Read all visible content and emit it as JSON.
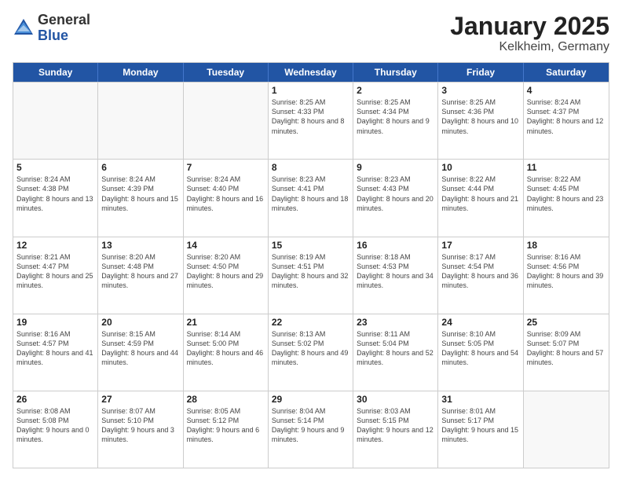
{
  "logo": {
    "general": "General",
    "blue": "Blue"
  },
  "title": "January 2025",
  "location": "Kelkheim, Germany",
  "header_days": [
    "Sunday",
    "Monday",
    "Tuesday",
    "Wednesday",
    "Thursday",
    "Friday",
    "Saturday"
  ],
  "weeks": [
    [
      {
        "day": "",
        "info": ""
      },
      {
        "day": "",
        "info": ""
      },
      {
        "day": "",
        "info": ""
      },
      {
        "day": "1",
        "info": "Sunrise: 8:25 AM\nSunset: 4:33 PM\nDaylight: 8 hours\nand 8 minutes."
      },
      {
        "day": "2",
        "info": "Sunrise: 8:25 AM\nSunset: 4:34 PM\nDaylight: 8 hours\nand 9 minutes."
      },
      {
        "day": "3",
        "info": "Sunrise: 8:25 AM\nSunset: 4:36 PM\nDaylight: 8 hours\nand 10 minutes."
      },
      {
        "day": "4",
        "info": "Sunrise: 8:24 AM\nSunset: 4:37 PM\nDaylight: 8 hours\nand 12 minutes."
      }
    ],
    [
      {
        "day": "5",
        "info": "Sunrise: 8:24 AM\nSunset: 4:38 PM\nDaylight: 8 hours\nand 13 minutes."
      },
      {
        "day": "6",
        "info": "Sunrise: 8:24 AM\nSunset: 4:39 PM\nDaylight: 8 hours\nand 15 minutes."
      },
      {
        "day": "7",
        "info": "Sunrise: 8:24 AM\nSunset: 4:40 PM\nDaylight: 8 hours\nand 16 minutes."
      },
      {
        "day": "8",
        "info": "Sunrise: 8:23 AM\nSunset: 4:41 PM\nDaylight: 8 hours\nand 18 minutes."
      },
      {
        "day": "9",
        "info": "Sunrise: 8:23 AM\nSunset: 4:43 PM\nDaylight: 8 hours\nand 20 minutes."
      },
      {
        "day": "10",
        "info": "Sunrise: 8:22 AM\nSunset: 4:44 PM\nDaylight: 8 hours\nand 21 minutes."
      },
      {
        "day": "11",
        "info": "Sunrise: 8:22 AM\nSunset: 4:45 PM\nDaylight: 8 hours\nand 23 minutes."
      }
    ],
    [
      {
        "day": "12",
        "info": "Sunrise: 8:21 AM\nSunset: 4:47 PM\nDaylight: 8 hours\nand 25 minutes."
      },
      {
        "day": "13",
        "info": "Sunrise: 8:20 AM\nSunset: 4:48 PM\nDaylight: 8 hours\nand 27 minutes."
      },
      {
        "day": "14",
        "info": "Sunrise: 8:20 AM\nSunset: 4:50 PM\nDaylight: 8 hours\nand 29 minutes."
      },
      {
        "day": "15",
        "info": "Sunrise: 8:19 AM\nSunset: 4:51 PM\nDaylight: 8 hours\nand 32 minutes."
      },
      {
        "day": "16",
        "info": "Sunrise: 8:18 AM\nSunset: 4:53 PM\nDaylight: 8 hours\nand 34 minutes."
      },
      {
        "day": "17",
        "info": "Sunrise: 8:17 AM\nSunset: 4:54 PM\nDaylight: 8 hours\nand 36 minutes."
      },
      {
        "day": "18",
        "info": "Sunrise: 8:16 AM\nSunset: 4:56 PM\nDaylight: 8 hours\nand 39 minutes."
      }
    ],
    [
      {
        "day": "19",
        "info": "Sunrise: 8:16 AM\nSunset: 4:57 PM\nDaylight: 8 hours\nand 41 minutes."
      },
      {
        "day": "20",
        "info": "Sunrise: 8:15 AM\nSunset: 4:59 PM\nDaylight: 8 hours\nand 44 minutes."
      },
      {
        "day": "21",
        "info": "Sunrise: 8:14 AM\nSunset: 5:00 PM\nDaylight: 8 hours\nand 46 minutes."
      },
      {
        "day": "22",
        "info": "Sunrise: 8:13 AM\nSunset: 5:02 PM\nDaylight: 8 hours\nand 49 minutes."
      },
      {
        "day": "23",
        "info": "Sunrise: 8:11 AM\nSunset: 5:04 PM\nDaylight: 8 hours\nand 52 minutes."
      },
      {
        "day": "24",
        "info": "Sunrise: 8:10 AM\nSunset: 5:05 PM\nDaylight: 8 hours\nand 54 minutes."
      },
      {
        "day": "25",
        "info": "Sunrise: 8:09 AM\nSunset: 5:07 PM\nDaylight: 8 hours\nand 57 minutes."
      }
    ],
    [
      {
        "day": "26",
        "info": "Sunrise: 8:08 AM\nSunset: 5:08 PM\nDaylight: 9 hours\nand 0 minutes."
      },
      {
        "day": "27",
        "info": "Sunrise: 8:07 AM\nSunset: 5:10 PM\nDaylight: 9 hours\nand 3 minutes."
      },
      {
        "day": "28",
        "info": "Sunrise: 8:05 AM\nSunset: 5:12 PM\nDaylight: 9 hours\nand 6 minutes."
      },
      {
        "day": "29",
        "info": "Sunrise: 8:04 AM\nSunset: 5:14 PM\nDaylight: 9 hours\nand 9 minutes."
      },
      {
        "day": "30",
        "info": "Sunrise: 8:03 AM\nSunset: 5:15 PM\nDaylight: 9 hours\nand 12 minutes."
      },
      {
        "day": "31",
        "info": "Sunrise: 8:01 AM\nSunset: 5:17 PM\nDaylight: 9 hours\nand 15 minutes."
      },
      {
        "day": "",
        "info": ""
      }
    ]
  ]
}
